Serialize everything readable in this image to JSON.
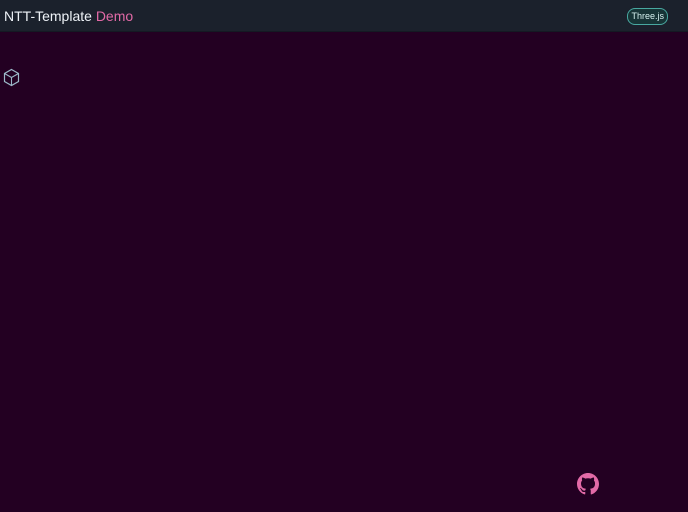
{
  "header": {
    "title_main": "NTT-Template",
    "title_accent": "Demo",
    "badge_label": "Three.js"
  },
  "icons": {
    "scene_object": "hexagonal-cube-icon",
    "repository": "github-icon"
  },
  "colors": {
    "background": "#230022",
    "header_background": "#1b212c",
    "accent": "#e26aa7",
    "badge_border": "#48a8a0"
  }
}
